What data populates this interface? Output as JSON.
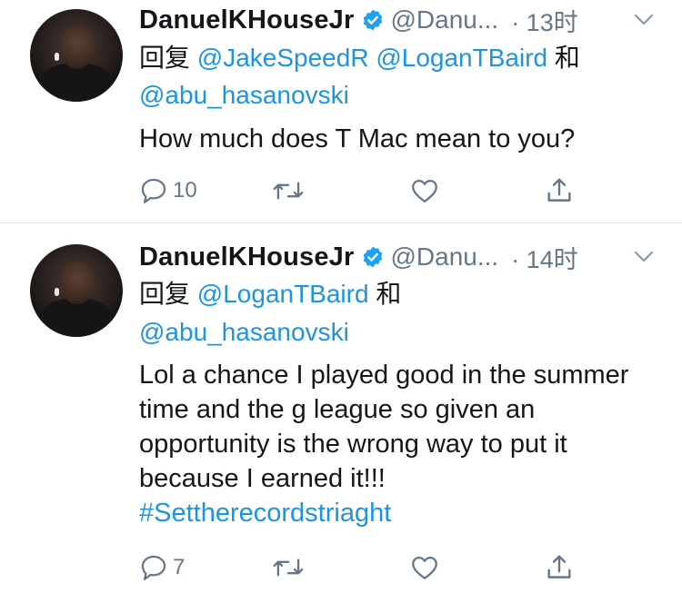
{
  "tweets": [
    {
      "name": "DanuelKHouseJr",
      "handle": "@Danu...",
      "time": "· 13时",
      "reply_prefix": "回复",
      "mentions_line1": [
        "@JakeSpeedR",
        "@LoganTBaird"
      ],
      "and_word": "和",
      "mention_line2": "@abu_hasanovski",
      "text": "How much does T Mac mean to you?",
      "hashtag": "",
      "reply_count": "10"
    },
    {
      "name": "DanuelKHouseJr",
      "handle": "@Danu...",
      "time": "· 14时",
      "reply_prefix": "回复",
      "mentions_line1": [
        "@LoganTBaird"
      ],
      "and_word": "和",
      "mention_line2": "@abu_hasanovski",
      "text": "Lol a chance I played good in the summer time and the g league so given an opportunity is the wrong way to put it because I earned it!!!",
      "hashtag": "#Settherecordstriaght",
      "reply_count": "7"
    }
  ],
  "colors": {
    "link": "#1b95e0",
    "secondary": "#657786",
    "text": "#14171a",
    "divider": "#e1e8ed"
  },
  "icons": [
    "verified-badge-icon",
    "chevron-down-icon",
    "reply-icon",
    "retweet-icon",
    "like-icon",
    "share-icon"
  ]
}
